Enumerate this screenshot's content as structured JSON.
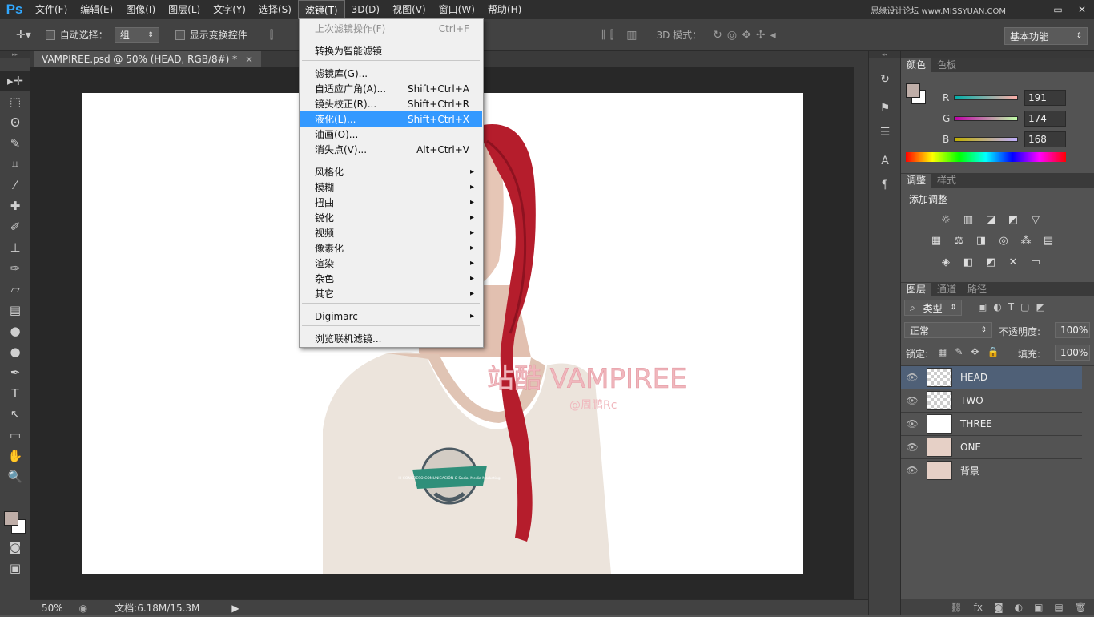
{
  "app": {
    "logo": "Ps"
  },
  "menubar": {
    "items": [
      "文件(F)",
      "编辑(E)",
      "图像(I)",
      "图层(L)",
      "文字(Y)",
      "选择(S)",
      "滤镜(T)",
      "3D(D)",
      "视图(V)",
      "窗口(W)",
      "帮助(H)"
    ],
    "active_index": 6,
    "site_watermark": "思缘设计论坛 www.MISSYUAN.COM"
  },
  "window_controls": {
    "minimize": "—",
    "restore": "▭",
    "close": "✕"
  },
  "options_bar": {
    "auto_select_label": "自动选择：",
    "auto_select_value": "组",
    "show_transform_label": "显示变换控件",
    "mode_3d_label": "3D 模式：",
    "workspace": "基本功能"
  },
  "document": {
    "tab_title": "VAMPIREE.psd @ 50% (HEAD, RGB/8#) *",
    "close_glyph": "×"
  },
  "canvas_art": {
    "title": "站酷 VAMPIREE",
    "subtitle": "@周鹏Rc",
    "shirt_badge": "III CONGRESO COMUNICACIÓN & Social Media Marketing",
    "title_color": "#f0b7bd",
    "hair_color": "#b51d2c",
    "shirt_color": "#ece4dc",
    "skin_color": "#e2c0b0",
    "badge_color": "#2f8f7a"
  },
  "status": {
    "zoom": "50%",
    "doc_info": "文档:6.18M/15.3M"
  },
  "filter_menu": {
    "items": [
      {
        "label": "上次滤镜操作(F)",
        "shortcut": "Ctrl+F",
        "disabled": true
      },
      {
        "label": "转换为智能滤镜",
        "shortcut": ""
      },
      {
        "label": "滤镜库(G)...",
        "shortcut": ""
      },
      {
        "label": "自适应广角(A)...",
        "shortcut": "Shift+Ctrl+A"
      },
      {
        "label": "镜头校正(R)...",
        "shortcut": "Shift+Ctrl+R"
      },
      {
        "label": "液化(L)...",
        "shortcut": "Shift+Ctrl+X",
        "highlighted": true
      },
      {
        "label": "油画(O)...",
        "shortcut": ""
      },
      {
        "label": "消失点(V)...",
        "shortcut": "Alt+Ctrl+V"
      },
      {
        "label": "风格化",
        "shortcut": "",
        "submenu": true
      },
      {
        "label": "模糊",
        "shortcut": "",
        "submenu": true
      },
      {
        "label": "扭曲",
        "shortcut": "",
        "submenu": true
      },
      {
        "label": "锐化",
        "shortcut": "",
        "submenu": true
      },
      {
        "label": "视频",
        "shortcut": "",
        "submenu": true
      },
      {
        "label": "像素化",
        "shortcut": "",
        "submenu": true
      },
      {
        "label": "渲染",
        "shortcut": "",
        "submenu": true
      },
      {
        "label": "杂色",
        "shortcut": "",
        "submenu": true
      },
      {
        "label": "其它",
        "shortcut": "",
        "submenu": true
      },
      {
        "label": "Digimarc",
        "shortcut": "",
        "submenu": true
      },
      {
        "label": "浏览联机滤镜...",
        "shortcut": ""
      }
    ]
  },
  "color_panel": {
    "tabs": [
      "颜色",
      "色板"
    ],
    "r_label": "R",
    "g_label": "G",
    "b_label": "B",
    "r": "191",
    "g": "174",
    "b": "168",
    "foreground": "#bfaea8"
  },
  "adjust_panel": {
    "tabs": [
      "调整",
      "样式"
    ],
    "heading": "添加调整",
    "icons_row1": [
      "☼",
      "▥",
      "◪",
      "◩",
      "▽"
    ],
    "icons_row2": [
      "▦",
      "⚖",
      "◨",
      "◎",
      "⁂",
      "▤"
    ],
    "icons_row3": [
      "◈",
      "◧",
      "◩",
      "✕",
      "▭"
    ]
  },
  "layers_panel": {
    "tabs": [
      "图层",
      "通道",
      "路径"
    ],
    "filter_label": "类型",
    "blend_mode": "正常",
    "opacity_label": "不透明度:",
    "opacity": "100%",
    "lock_label": "锁定:",
    "fill_label": "填充:",
    "fill": "100%",
    "layers": [
      {
        "name": "HEAD",
        "thumb": "checker",
        "selected": true
      },
      {
        "name": "TWO",
        "thumb": "checker"
      },
      {
        "name": "THREE",
        "thumb": "white"
      },
      {
        "name": "ONE",
        "thumb": "photo"
      },
      {
        "name": "背景",
        "thumb": "photo"
      }
    ],
    "footer_icons": [
      "⛓",
      "fx",
      "◙",
      "◐",
      "▣",
      "▤",
      "🗑"
    ]
  },
  "tools": [
    "▸✛",
    "⬚",
    "ʘ",
    "✎",
    "⌗",
    "⁄",
    "✚",
    "✐",
    "⊥",
    "✑",
    "▱",
    "▤",
    "●",
    "●",
    "✒",
    "T",
    "↖",
    "▭",
    "✋",
    "🔍"
  ]
}
